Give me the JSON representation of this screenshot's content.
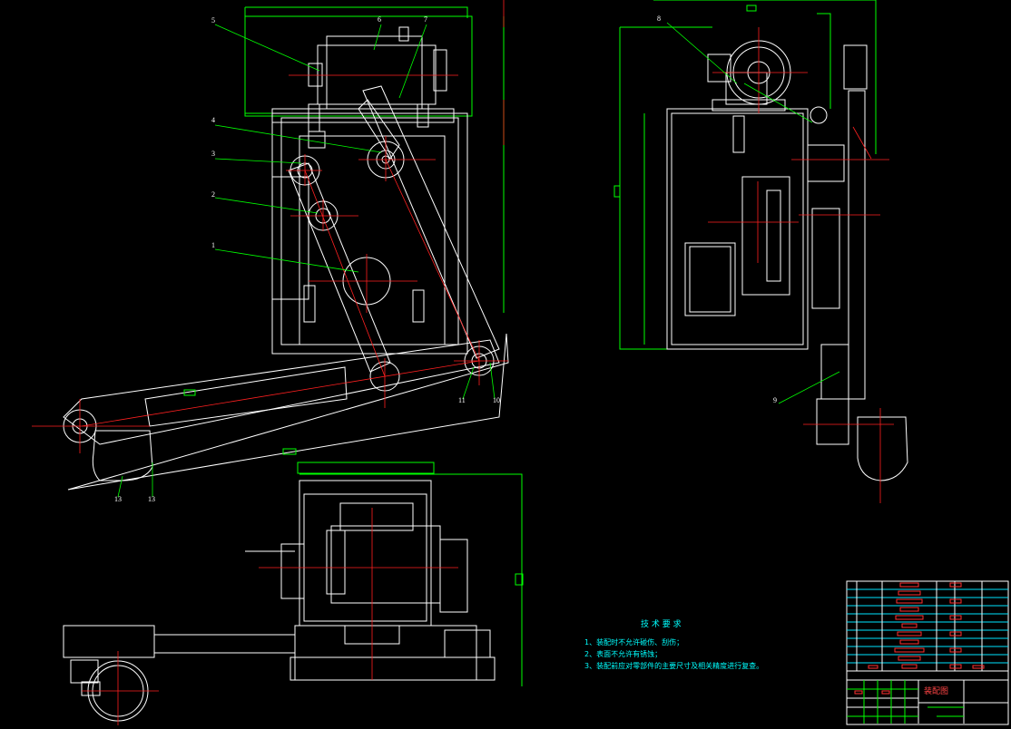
{
  "colors": {
    "background": "#000000",
    "outline": "#ffffff",
    "centerline": "#ff2020",
    "leader": "#00ff00",
    "dimension": "#00ff00",
    "text": "#00ffff",
    "titleblock_red": "#ff3030",
    "titleblock_cyan": "#00e5ff",
    "titleblock_green": "#00ff00"
  },
  "part_labels": [
    "5",
    "6",
    "7",
    "4",
    "3",
    "2",
    "1",
    "11",
    "10",
    "13",
    "13",
    "8",
    "9"
  ],
  "technical_requirements": {
    "heading": "技 术 要 求",
    "items": [
      "1、装配时不允许碰伤、刮伤；",
      "2、表面不允许有锈蚀；",
      "3、装配前应对零部件的主要尺寸及相关精度进行复查。"
    ]
  },
  "title_block": {
    "drawing_title": "装配图"
  }
}
